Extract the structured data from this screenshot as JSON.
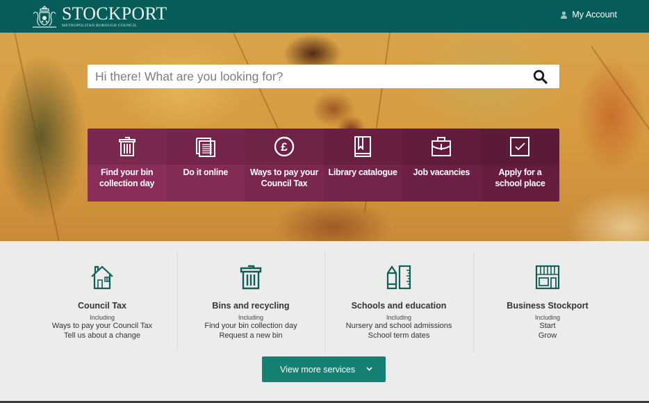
{
  "header": {
    "logo_title": "STOCKPORT",
    "logo_subtitle": "METROPOLITAN BOROUGH COUNCIL",
    "account_label": "My Account",
    "account_icon": "user-icon",
    "background_color": "#055c58"
  },
  "search": {
    "placeholder": "Hi there! What are you looking for?",
    "value": "",
    "button_icon": "search-icon"
  },
  "quick_links": [
    {
      "label": "Find your bin collection day",
      "icon": "bin-icon",
      "color": "#8a2d5a"
    },
    {
      "label": "Do it online",
      "icon": "documents-icon",
      "color": "#832a55"
    },
    {
      "label": "Ways to pay your Council Tax",
      "icon": "pound-icon",
      "color": "#7b2750"
    },
    {
      "label": "Library catalogue",
      "icon": "book-icon",
      "color": "#74234a"
    },
    {
      "label": "Job vacancies",
      "icon": "briefcase-icon",
      "color": "#6d2045"
    },
    {
      "label": "Apply for a school place",
      "icon": "checkbox-icon",
      "color": "#671d40"
    }
  ],
  "services": [
    {
      "title": "Council Tax",
      "including": "Including",
      "links": [
        "Ways to pay your Council Tax",
        "Tell us about a change"
      ],
      "icon": "house-icon"
    },
    {
      "title": "Bins and recycling",
      "including": "Including",
      "links": [
        "Find your bin collection day",
        "Request a new bin"
      ],
      "icon": "bin-icon"
    },
    {
      "title": "Schools and education",
      "including": "Including",
      "links": [
        "Nursery and school admissions",
        "School term dates"
      ],
      "icon": "pencil-ruler-icon"
    },
    {
      "title": "Business Stockport",
      "including": "Including",
      "links": [
        "Start",
        "Grow"
      ],
      "icon": "shopfront-icon"
    }
  ],
  "view_more": {
    "label": "View more services",
    "icon": "chevron-down-icon",
    "color": "#168073"
  },
  "colors": {
    "accent_teal": "#055c58",
    "icon_teal": "#0f5e57",
    "tile_purple": "#7b2750"
  }
}
